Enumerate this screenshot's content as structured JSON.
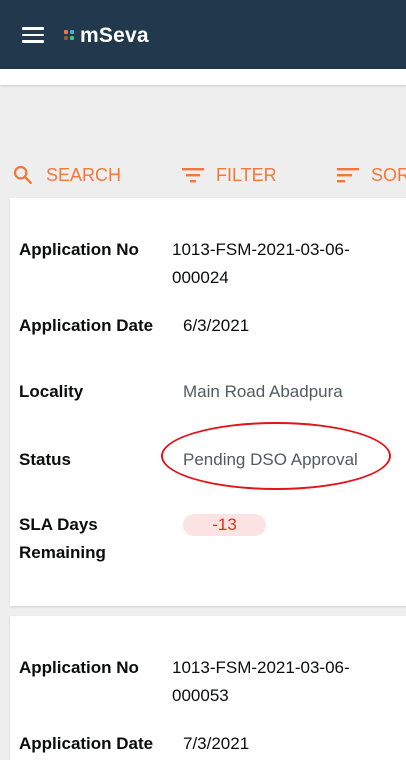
{
  "header": {
    "app_name": "mSeva",
    "menu_icon": "hamburger-menu-icon",
    "logo_colors": [
      "#f47738",
      "#3fb0e0",
      "#46c27d"
    ],
    "background": "#22394d"
  },
  "actions": [
    {
      "label": "SEARCH",
      "icon": "search-icon"
    },
    {
      "label": "FILTER",
      "icon": "filter-icon"
    },
    {
      "label": "SORT",
      "icon": "sort-icon"
    }
  ],
  "accent_color": "#f47738",
  "applications": [
    {
      "app_no_label": "Application No",
      "app_no": "1013-FSM-2021-03-06-000024",
      "date_label": "Application Date",
      "date": "6/3/2021",
      "locality_label": "Locality",
      "locality": "Main Road Abadpura",
      "status_label": "Status",
      "status": "Pending DSO Approval",
      "sla_label": "SLA Days Remaining",
      "sla": "-13"
    },
    {
      "app_no_label": "Application No",
      "app_no": "1013-FSM-2021-03-06-000053",
      "date_label": "Application Date",
      "date": "7/3/2021"
    }
  ]
}
